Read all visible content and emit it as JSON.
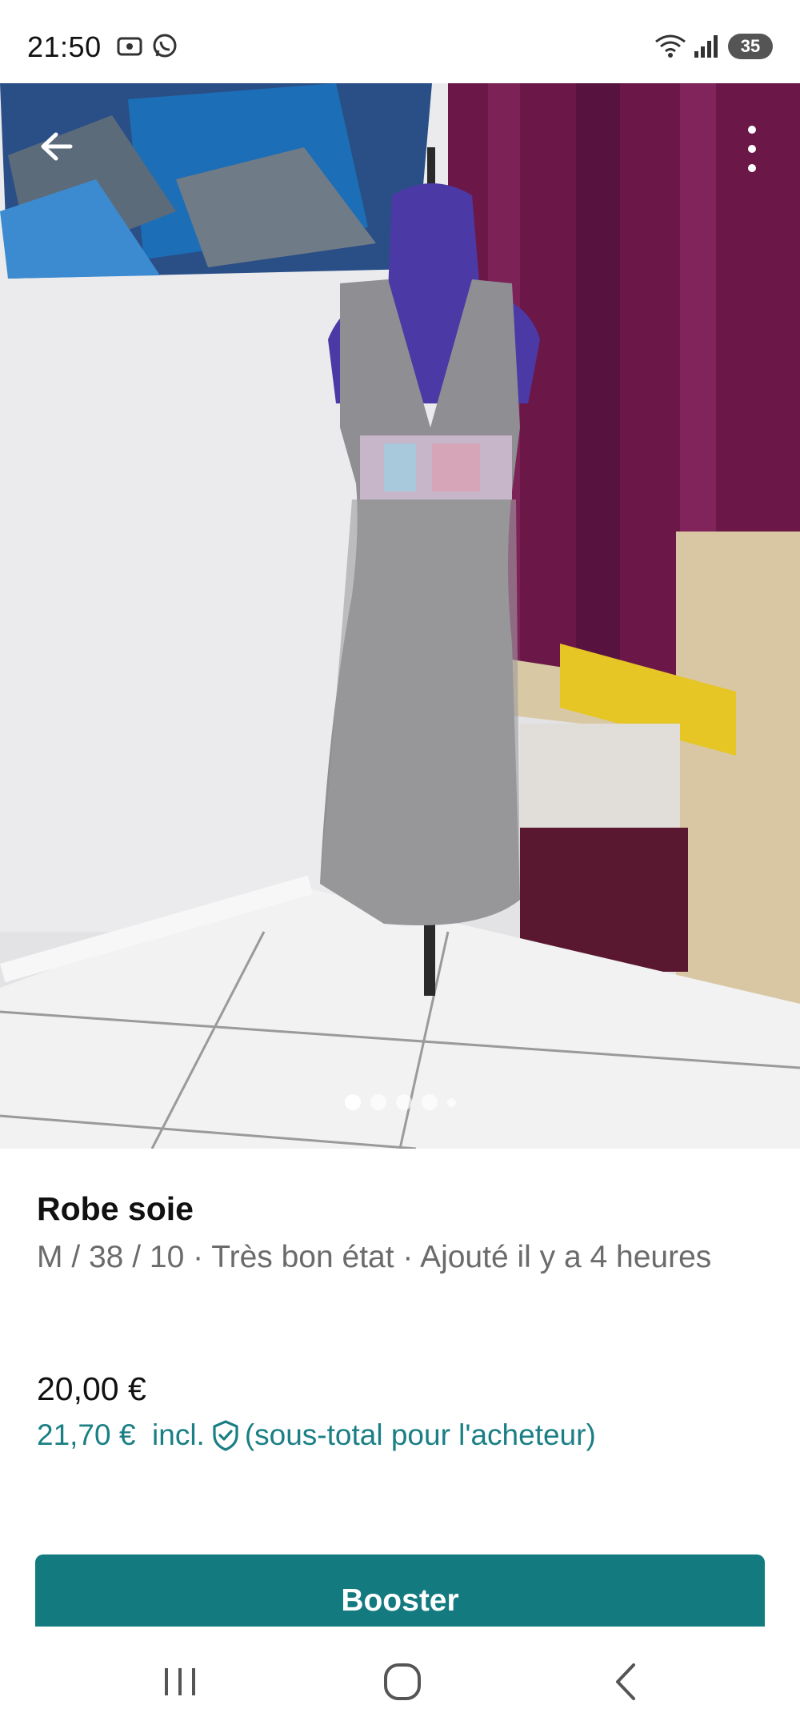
{
  "status_bar": {
    "time": "21:50",
    "battery": "35"
  },
  "listing": {
    "title": "Robe soie",
    "meta": "M / 38 / 10 · Très bon état · Ajouté il y a 4 heures",
    "price": "20,00 €",
    "price_incl_amount": "21,70 €",
    "price_incl_label": "incl.",
    "price_incl_note": "(sous-total pour l'acheteur)"
  },
  "gallery": {
    "photo_count": 5,
    "active_index": 0
  },
  "actions": {
    "booster_label": "Booster"
  },
  "colors": {
    "accent": "#137a80",
    "link_teal": "#1a7f84",
    "meta_gray": "#6b6b6b"
  },
  "icons": [
    "back-arrow-icon",
    "more-vertical-icon",
    "shield-check-icon",
    "recents-icon",
    "home-icon",
    "back-icon"
  ]
}
